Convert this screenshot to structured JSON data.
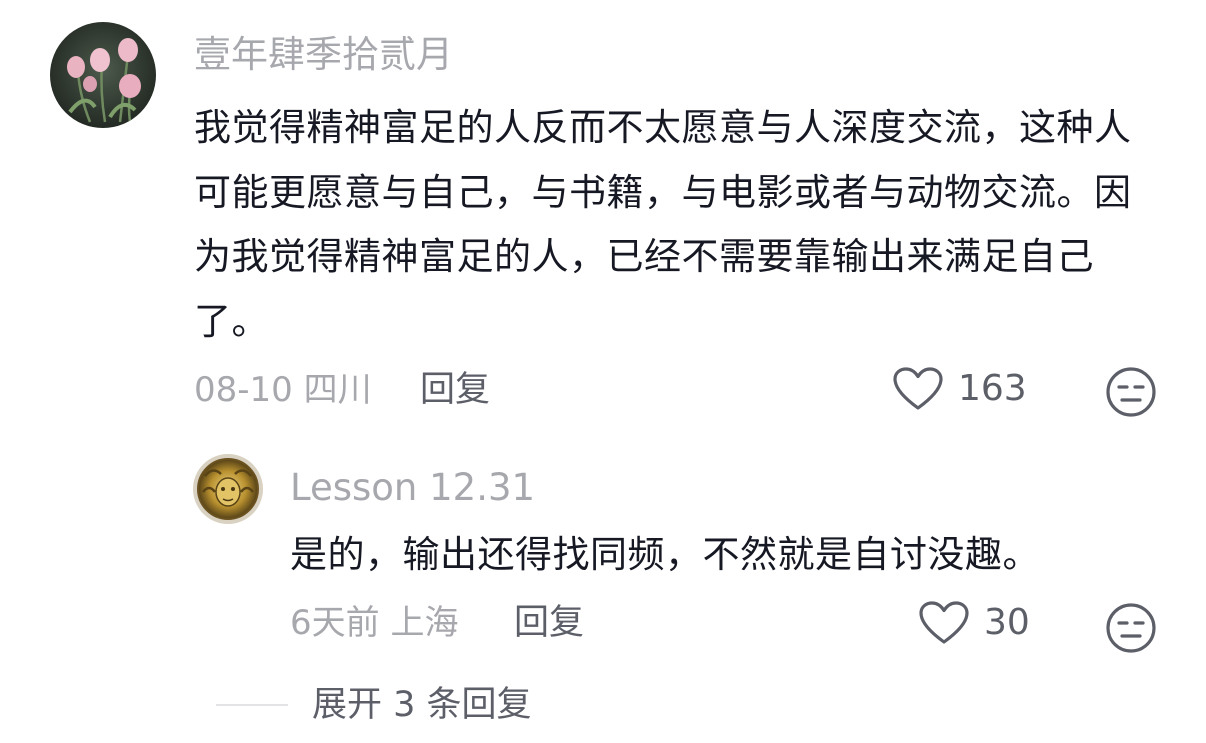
{
  "comment": {
    "username": "壹年肆季拾贰月",
    "avatar_icon": "tulip-flowers-avatar",
    "text": "我觉得精神富足的人反而不太愿意与人深度交流，这种人可能更愿意与自己，与书籍，与电影或者与动物交流。因为我觉得精神富足的人，已经不需要靠输出来满足自己了。",
    "date_location": "08-10 四川",
    "reply_label": "回复",
    "like_count": "163",
    "like_icon": "heart-outline-icon",
    "dislike_icon": "unamused-face-icon"
  },
  "reply": {
    "username": "Lesson 12.31",
    "avatar_icon": "gold-medusa-avatar",
    "text": "是的，输出还得找同频，不然就是自讨没趣。",
    "date_location": "6天前 上海",
    "reply_label": "回复",
    "like_count": "30",
    "like_icon": "heart-outline-icon",
    "dislike_icon": "unamused-face-icon"
  },
  "expand_replies": {
    "label": "展开 3 条回复"
  },
  "colors": {
    "primary_text": "#161823",
    "secondary_text": "#a7a8ad",
    "action_text": "#5c5e68",
    "divider": "#e3e3e5"
  }
}
